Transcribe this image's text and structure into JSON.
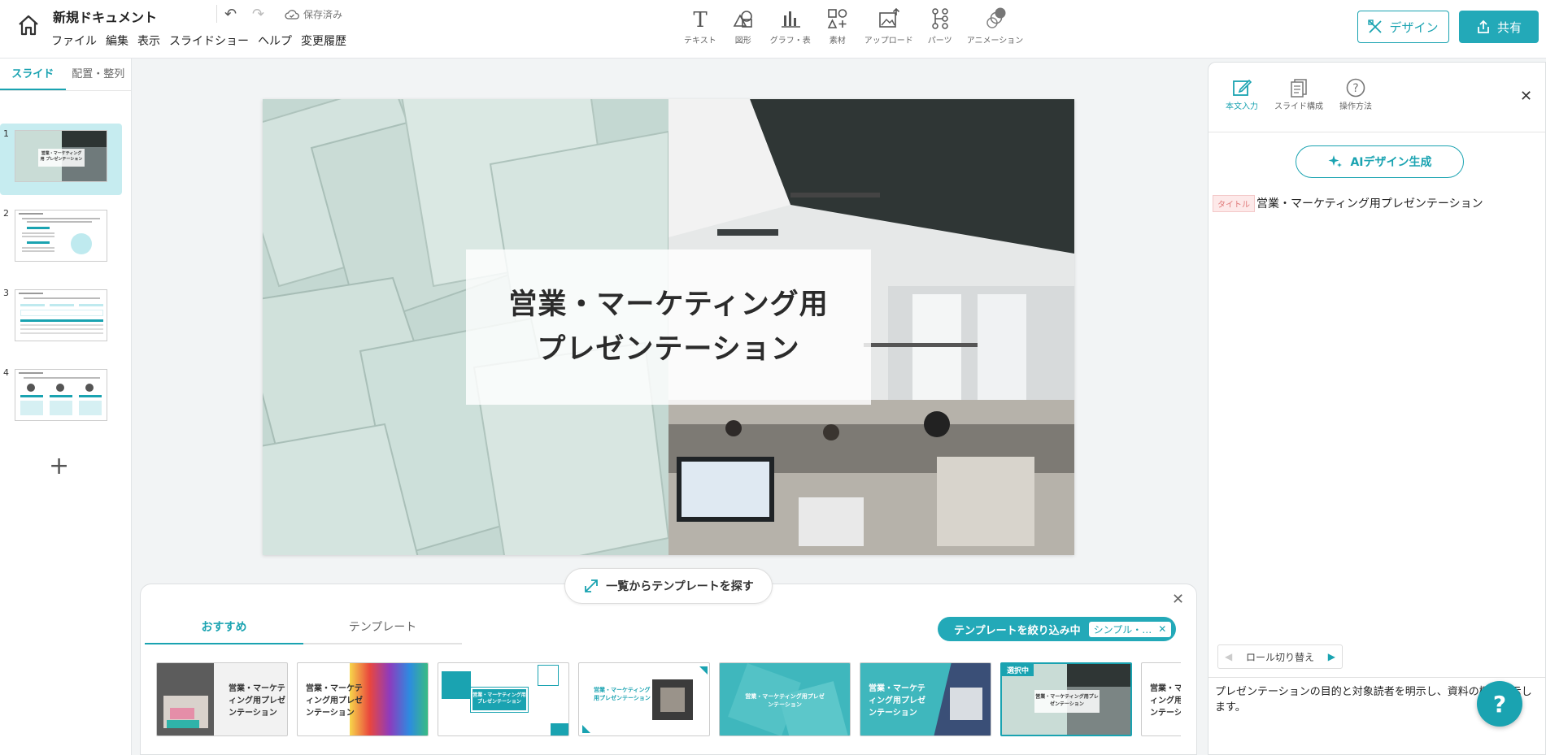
{
  "header": {
    "doc_title": "新規ドキュメント",
    "saved_status": "保存済み",
    "menu": [
      "ファイル",
      "編集",
      "表示",
      "スライドショー",
      "ヘルプ",
      "変更履歴"
    ],
    "tools": [
      "テキスト",
      "図形",
      "グラフ・表",
      "素材",
      "アップロード",
      "パーツ",
      "アニメーション"
    ],
    "design_label": "デザイン",
    "share_label": "共有"
  },
  "sidebar": {
    "tabs": [
      "スライド",
      "配置・整列"
    ],
    "slides": [
      {
        "num": "1",
        "mini_title": "営業・マーケティング用 プレゼンテーション"
      },
      {
        "num": "2"
      },
      {
        "num": "3"
      },
      {
        "num": "4"
      }
    ],
    "add_icon": "plus-icon"
  },
  "slide": {
    "title_line1": "営業・マーケティング用",
    "title_line2": "プレゼンテーション"
  },
  "template_panel": {
    "browse_label": "一覧からテンプレートを探す",
    "tabs": [
      "おすすめ",
      "テンプレート"
    ],
    "filter_label": "テンプレートを絞り込み中",
    "filter_chip": "シンプル・…",
    "selected_badge": "選択中",
    "cards": [
      {
        "text": "営業・マーケティング用プレゼンテーション"
      },
      {
        "text": "営業・マーケティング用プレゼンテーション"
      },
      {
        "text": "営業・マーケティング用プレゼンテーション"
      },
      {
        "text": "営業・マーケティング用プレゼンテーション"
      },
      {
        "text": "営業・マーケティング用プレゼンテーション"
      },
      {
        "text": "営業・マーケティング用プレゼンテーション"
      },
      {
        "text": "営業・マーケティング用プレゼンテーション"
      },
      {
        "text": "営業・マーケティング用プレゼンテーション"
      }
    ]
  },
  "right_panel": {
    "tools": [
      "本文入力",
      "スライド構成",
      "操作方法"
    ],
    "ai_button": "AIデザイン生成",
    "role_tag": "タイトル",
    "role_text": "営業・マーケティング用プレゼンテーション",
    "role_switch": "ロール切り替え",
    "body_text": "プレゼンテーションの目的と対象読者を明示し、資料の概要を示します。",
    "help_icon": "question-icon"
  },
  "colors": {
    "accent": "#1aa3b1",
    "accent_light": "#c6ecf0"
  }
}
